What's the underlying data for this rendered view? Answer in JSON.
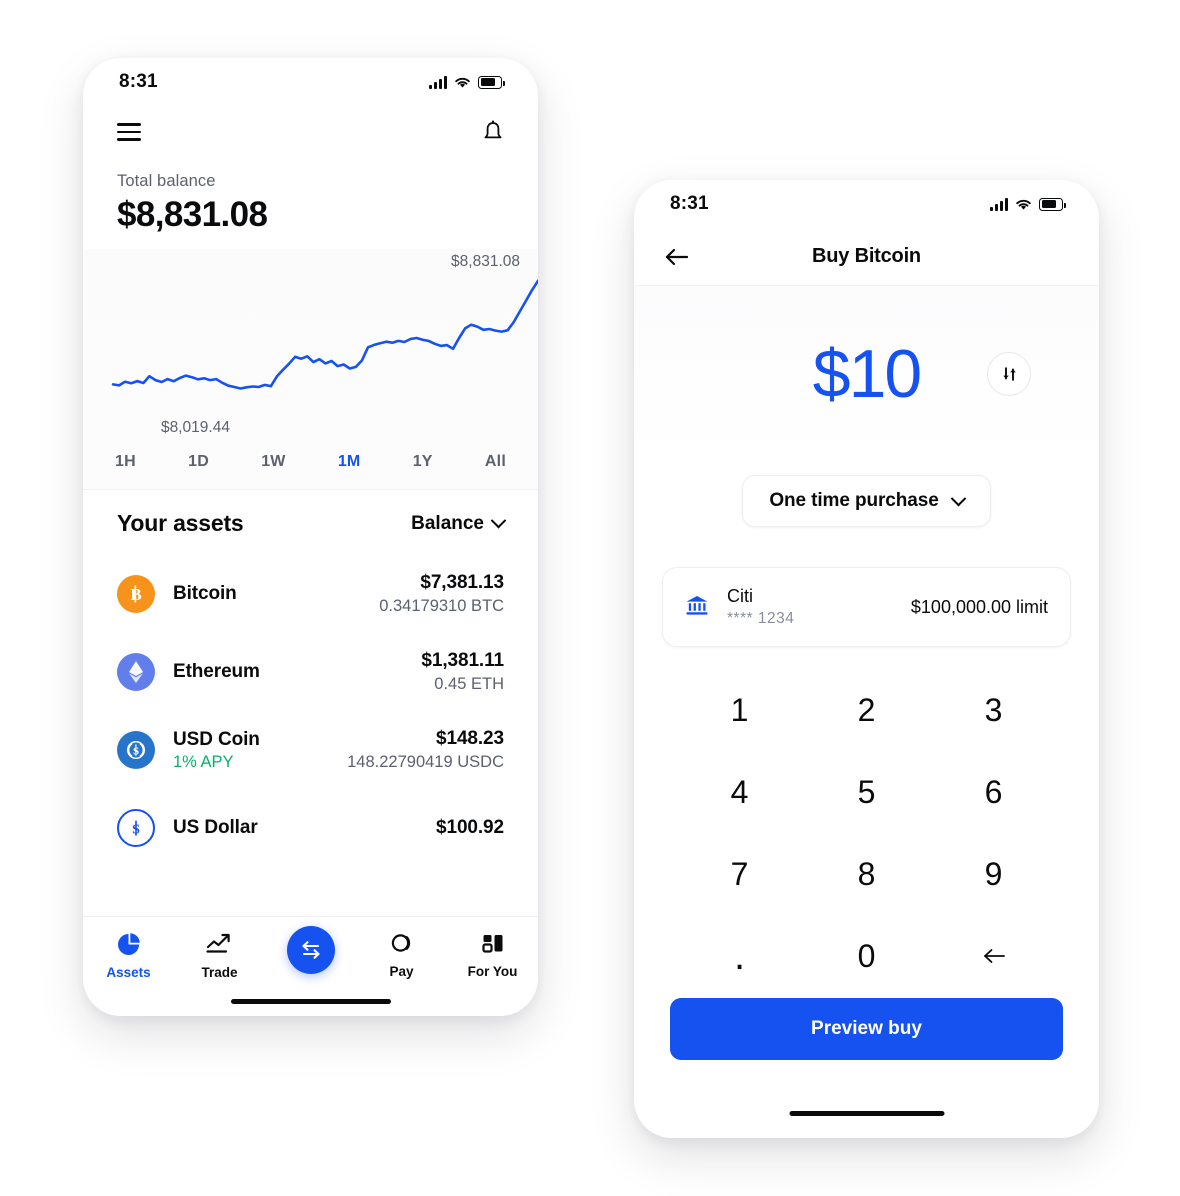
{
  "accent_color": "#1652f0",
  "colors": {
    "accent": "#1652f0",
    "text_primary": "#0a0b0d",
    "text_secondary": "#5b616e",
    "green_apy": "#05b169",
    "bitcoin_orange": "#f7931a",
    "ethereum_purple": "#627eea",
    "usdc_blue": "#2775ca"
  },
  "left_phone": {
    "status_bar": {
      "time": "8:31",
      "signal": "signal-bars-icon",
      "wifi": "wifi-icon",
      "battery": "battery-icon"
    },
    "nav": {
      "menu": "hamburger-menu-icon",
      "notifications": "bell-icon"
    },
    "balance": {
      "label": "Total balance",
      "amount": "$8,831.08"
    },
    "chart": {
      "high_label": "$8,831.08",
      "low_label": "$8,019.44"
    },
    "ranges": [
      {
        "label": "1H",
        "active": false
      },
      {
        "label": "1D",
        "active": false
      },
      {
        "label": "1W",
        "active": false
      },
      {
        "label": "1M",
        "active": true
      },
      {
        "label": "1Y",
        "active": false
      },
      {
        "label": "All",
        "active": false
      }
    ],
    "assets_header": {
      "title": "Your assets",
      "sort_label": "Balance",
      "sort_icon": "chevron-down-icon"
    },
    "assets": [
      {
        "icon": "bitcoin-icon",
        "name": "Bitcoin",
        "sub": "",
        "value": "$7,381.13",
        "units": "0.34179310 BTC"
      },
      {
        "icon": "ethereum-icon",
        "name": "Ethereum",
        "sub": "",
        "value": "$1,381.11",
        "units": "0.45 ETH"
      },
      {
        "icon": "usdc-icon",
        "name": "USD Coin",
        "sub": "1% APY",
        "value": "$148.23",
        "units": "148.22790419 USDC"
      },
      {
        "icon": "usd-icon",
        "name": "US Dollar",
        "sub": "",
        "value": "$100.92",
        "units": ""
      }
    ],
    "tabs": [
      {
        "label": "Assets",
        "icon": "pie-chart-icon",
        "active": true,
        "fab": false
      },
      {
        "label": "Trade",
        "icon": "trend-up-icon",
        "active": false,
        "fab": false
      },
      {
        "label": "",
        "icon": "transfer-icon",
        "active": false,
        "fab": true
      },
      {
        "label": "Pay",
        "icon": "pay-icon",
        "active": false,
        "fab": false
      },
      {
        "label": "For You",
        "icon": "for-you-grid-icon",
        "active": false,
        "fab": false
      }
    ]
  },
  "right_phone": {
    "status_bar": {
      "time": "8:31",
      "signal": "signal-bars-icon",
      "wifi": "wifi-icon",
      "battery": "battery-icon"
    },
    "nav": {
      "back_icon": "back-arrow-icon",
      "title": "Buy Bitcoin"
    },
    "amount": {
      "value": "$10",
      "swap_icon": "swap-vertical-icon"
    },
    "frequency": {
      "label": "One time purchase",
      "icon": "chevron-down-icon"
    },
    "payment": {
      "icon": "bank-icon",
      "name": "Citi",
      "masked_number": "**** 1234",
      "limit": "$100,000.00 limit"
    },
    "keypad": [
      "1",
      "2",
      "3",
      "4",
      "5",
      "6",
      "7",
      "8",
      "9",
      ".",
      "0",
      "backspace-icon"
    ],
    "primary_button": {
      "label": "Preview buy"
    }
  },
  "chart_data": {
    "type": "line",
    "title": "",
    "xlabel": "",
    "ylabel": "",
    "series": [
      {
        "name": "Total balance",
        "values": [
          8050,
          8042,
          8070,
          8058,
          8075,
          8060,
          8112,
          8082,
          8068,
          8090,
          8074,
          8098,
          8116,
          8104,
          8088,
          8096,
          8082,
          8090,
          8062,
          8040,
          8030,
          8019,
          8028,
          8034,
          8030,
          8046,
          8036,
          8110,
          8160,
          8206,
          8258,
          8244,
          8262,
          8218,
          8240,
          8208,
          8226,
          8188,
          8200,
          8170,
          8182,
          8230,
          8330,
          8348,
          8360,
          8372,
          8364,
          8378,
          8370,
          8392,
          8400,
          8386,
          8378,
          8356,
          8340,
          8346,
          8318,
          8400,
          8472,
          8500,
          8486,
          8462,
          8468,
          8456,
          8448,
          8458,
          8520,
          8600,
          8680,
          8760,
          8831
        ]
      }
    ],
    "ylim": [
      8000,
      8860
    ],
    "annotations": [
      {
        "text": "$8,831.08",
        "position": "top-right"
      },
      {
        "text": "$8,019.44",
        "position": "bottom-left"
      }
    ],
    "grid": false,
    "legend": false,
    "line_color": "#1652f0"
  }
}
